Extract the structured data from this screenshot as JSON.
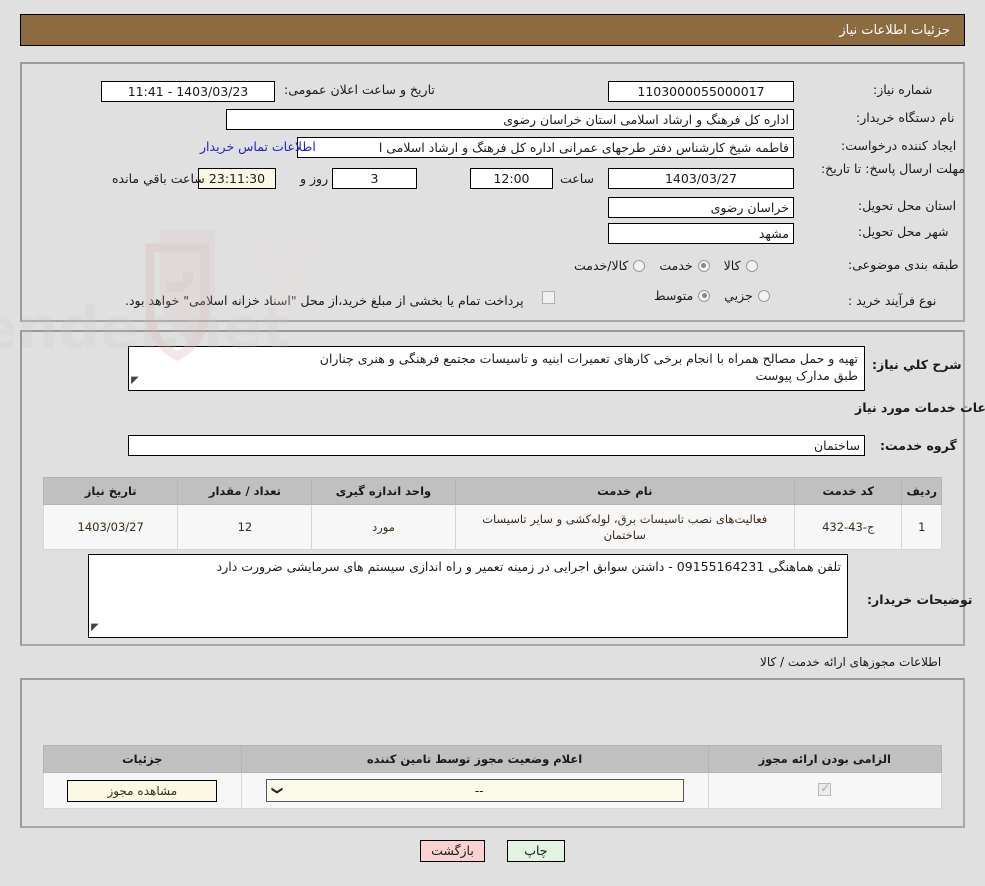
{
  "header": {
    "title": "جزئیات اطلاعات نیاز"
  },
  "fields": {
    "need_number_label": "شماره نیاز:",
    "need_number_value": "1103000055000017",
    "announce_label": "تاریخ و ساعت اعلان عمومی:",
    "announce_value": "1403/03/23 - 11:41",
    "buyer_org_label": "نام دستگاه خریدار:",
    "buyer_org_value": "اداره کل فرهنگ و ارشاد اسلامی استان خراسان رضوی",
    "creator_label": "ایجاد کننده درخواست:",
    "creator_value": "فاطمه شیخ کارشناس دفتر طرحهای عمرانی اداره کل فرهنگ و ارشاد اسلامی ا",
    "contact_link": "اطلاعات تماس خریدار",
    "deadline_label": "مهلت ارسال پاسخ: تا تاریخ:",
    "deadline_date": "1403/03/27",
    "hour_label": "ساعت",
    "deadline_time": "12:00",
    "days_value": "3",
    "days_label": "روز و",
    "countdown_value": "23:11:30",
    "remaining_label": "ساعت باقي مانده",
    "province_label": "استان محل تحویل:",
    "province_value": "خراسان رضوی",
    "city_label": "شهر محل تحویل:",
    "city_value": "مشهد",
    "category_label": "طبقه بندی موضوعی:",
    "purchase_type_label": "نوع فرآیند خرید :",
    "payment_note": "پرداخت تمام یا بخشی از مبلغ خرید،از محل \"اسناد خزانه اسلامی\" خواهد بود."
  },
  "category_options": [
    {
      "label": "کالا",
      "selected": false
    },
    {
      "label": "خدمت",
      "selected": true
    },
    {
      "label": "کالا/خدمت",
      "selected": false
    }
  ],
  "purchase_options": [
    {
      "label": "جزیي",
      "selected": false
    },
    {
      "label": "متوسط",
      "selected": true
    }
  ],
  "summary": {
    "label": "شرح کلي نياز:",
    "line1": "تهیه و حمل مصالح همراه با انجام برخی کارهای تعمیرات ابنیه و تاسیسات مجتمع فرهنگی و هنری چناران",
    "line2": "طبق مدارک پیوست"
  },
  "services": {
    "section_title": "اطلاعات خدمات مورد نیاز",
    "group_label": "گروه خدمت:",
    "group_value": "ساختمان",
    "headers": [
      "ردیف",
      "کد خدمت",
      "نام خدمت",
      "واحد اندازه گیری",
      "تعداد / مقدار",
      "تاریخ نیاز"
    ],
    "rows": [
      {
        "index": "1",
        "code": "ج-43-432",
        "name": "فعالیت‌های نصب تاسیسات برق، لوله‌کشی و سایر تاسیسات ساختمان",
        "unit": "مورد",
        "quantity": "12",
        "need_date": "1403/03/27"
      }
    ]
  },
  "buyer_notes": {
    "label": "توضیحات خریدار:",
    "value": "تلفن هماهنگی 09155164231 - داشتن سوابق اجرایی در زمینه تعمیر و راه اندازی سیستم های سرمایشی ضرورت دارد"
  },
  "permits": {
    "section_title": "اطلاعات مجوزهای ارائه خدمت / کالا",
    "headers": [
      "الزامی بودن ارائه مجوز",
      "اعلام وضعیت مجوز توسط تامین کننده",
      "جزئیات"
    ],
    "rows": [
      {
        "required": true,
        "status_value": "--",
        "details_button": "مشاهده مجوز"
      }
    ]
  },
  "footer": {
    "back_label": "بازگشت",
    "print_label": "چاپ"
  },
  "watermark": {
    "text": "AriaTender.net"
  },
  "colors": {
    "header_bg": "#8c6b3f",
    "page_bg": "#e0e0e0",
    "link": "#2222cc",
    "back_btn": "#fbd2d2",
    "print_btn": "#e2f3e2",
    "cream_field": "#fbf8e3"
  }
}
